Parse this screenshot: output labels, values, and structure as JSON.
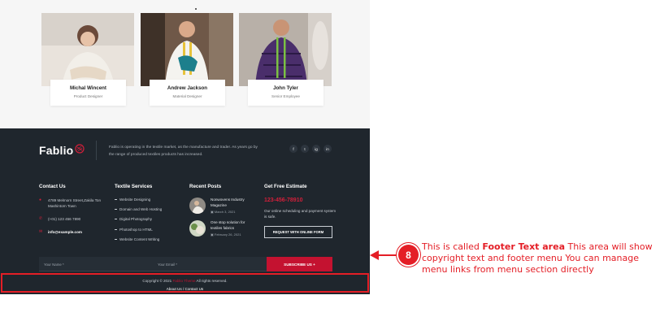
{
  "team": {
    "members": [
      {
        "name": "Michal Wincent",
        "role": "Product Designer"
      },
      {
        "name": "Andrew Jackson",
        "role": "Material Designer"
      },
      {
        "name": "John Tyler",
        "role": "Senior Employee"
      }
    ]
  },
  "footer": {
    "brand": "Fablio",
    "about": "Fablio is operating in the textile market, as the manufacture and trader. As years go by the range of produced textiles products has increased.",
    "socials": [
      "f",
      "t",
      "ig",
      "in"
    ],
    "contact": {
      "title": "Contact Us",
      "address": "4789 Melmorn Street,Zakila Ton Mashintorn Town",
      "phone": "(+01) 123 456 7890",
      "email": "info@example.com"
    },
    "services": {
      "title": "Textile Services",
      "items": [
        "Website Designing",
        "Domain and Web Hosting",
        "Digital Photography",
        "Photoshop to HTML",
        "Website Content Writing"
      ]
    },
    "posts": {
      "title": "Recent Posts",
      "items": [
        {
          "title": "Nonwovens Industry Magazine",
          "date": "March 3, 2021"
        },
        {
          "title": "One stop solution for textiles fabrics",
          "date": "February 26, 2021"
        }
      ]
    },
    "estimate": {
      "title": "Get Free Estimate",
      "phone": "123-456-78910",
      "text": "Our online scheduling and payment system is safe.",
      "button": "REQUEST WITH ONLINE FORM"
    },
    "subscribe": {
      "name_placeholder": "Your Name *",
      "email_placeholder": "Your Email *",
      "button": "SUBSCRIBE US +"
    },
    "copyright": {
      "prefix": "Copyright © 2021",
      "brand_link": "Fablio Theme",
      "suffix": "All rights reserved.",
      "menu": [
        "About Us",
        "Contact Us"
      ]
    }
  },
  "annotation": {
    "badge": "8",
    "intro": "This is called",
    "bold": "Footer Text area",
    "rest": "This area will show copyright text and footer menu You can manage menu links from menu section directly"
  },
  "colors": {
    "accent": "#c41230",
    "footer_bg": "#1f262d",
    "annotation": "#e41e26"
  }
}
